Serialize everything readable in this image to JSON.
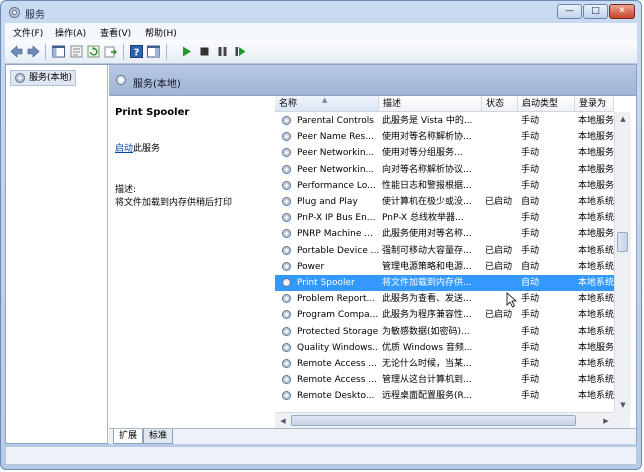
{
  "window": {
    "title": "服务",
    "minimize": "—",
    "maximize": "□",
    "close": "✕"
  },
  "menu": [
    "文件(F)",
    "操作(A)",
    "查看(V)",
    "帮助(H)"
  ],
  "toolbar": {
    "icons": [
      "back-icon",
      "forward-icon",
      "show-tree-icon",
      "properties-icon",
      "refresh-icon",
      "export-icon",
      "help-icon",
      "view-icon",
      "start-icon",
      "stop-icon",
      "pause-icon",
      "restart-icon"
    ]
  },
  "tree": {
    "root": "服务(本地)"
  },
  "content": {
    "header": "服务(本地)",
    "detail": {
      "title": "Print Spooler",
      "action_link": "启动",
      "action_suffix": "此服务",
      "desc_label": "描述:",
      "desc": "将文件加载到内存供稍后打印"
    },
    "columns": [
      "名称",
      "描述",
      "状态",
      "启动类型",
      "登录为"
    ],
    "rows": [
      {
        "name": "Parental Controls",
        "desc": "此服务是 Vista 中的...",
        "status": "",
        "startup": "手动",
        "logon": "本地服务"
      },
      {
        "name": "Peer Name Res...",
        "desc": "使用对等名称解析协...",
        "status": "",
        "startup": "手动",
        "logon": "本地服务"
      },
      {
        "name": "Peer Networkin...",
        "desc": "使用对等分组服务...",
        "status": "",
        "startup": "手动",
        "logon": "本地服务"
      },
      {
        "name": "Peer Networkin...",
        "desc": "向对等名称解析协议...",
        "status": "",
        "startup": "手动",
        "logon": "本地服务"
      },
      {
        "name": "Performance Lo...",
        "desc": "性能日志和警报根据...",
        "status": "",
        "startup": "手动",
        "logon": "本地服务"
      },
      {
        "name": "Plug and Play",
        "desc": "使计算机在极少或没...",
        "status": "已启动",
        "startup": "自动",
        "logon": "本地系统"
      },
      {
        "name": "PnP-X IP Bus En...",
        "desc": "PnP-X 总线枚举器...",
        "status": "",
        "startup": "手动",
        "logon": "本地系统"
      },
      {
        "name": "PNRP Machine ...",
        "desc": "此服务使用对等名称...",
        "status": "",
        "startup": "手动",
        "logon": "本地服务"
      },
      {
        "name": "Portable Device ...",
        "desc": "强制可移动大容量存...",
        "status": "已启动",
        "startup": "手动",
        "logon": "本地系统"
      },
      {
        "name": "Power",
        "desc": "管理电源策略和电源...",
        "status": "已启动",
        "startup": "自动",
        "logon": "本地系统"
      },
      {
        "name": "Print Spooler",
        "desc": "将文件加载到内存供...",
        "status": "",
        "startup": "自动",
        "logon": "本地系统",
        "selected": true
      },
      {
        "name": "Problem Report...",
        "desc": "此服务为查看、发送...",
        "status": "",
        "startup": "手动",
        "logon": "本地系统"
      },
      {
        "name": "Program Compa...",
        "desc": "此服务为程序兼容性...",
        "status": "已启动",
        "startup": "手动",
        "logon": "本地系统"
      },
      {
        "name": "Protected Storage",
        "desc": "为敏感数据(如密码)...",
        "status": "",
        "startup": "手动",
        "logon": "本地系统"
      },
      {
        "name": "Quality Windows...",
        "desc": "优质 Windows 音频...",
        "status": "",
        "startup": "手动",
        "logon": "本地服务"
      },
      {
        "name": "Remote Access ...",
        "desc": "无论什么时候，当某...",
        "status": "",
        "startup": "手动",
        "logon": "本地系统"
      },
      {
        "name": "Remote Access ...",
        "desc": "管理从这台计算机到...",
        "status": "",
        "startup": "手动",
        "logon": "本地系统"
      },
      {
        "name": "Remote Deskto...",
        "desc": "远程桌面配置服务(R...",
        "status": "",
        "startup": "手动",
        "logon": "本地系统"
      }
    ],
    "tabs": [
      "扩展",
      "标准"
    ]
  },
  "colors": {
    "selection": "#3399ff",
    "link": "#0645ad"
  }
}
